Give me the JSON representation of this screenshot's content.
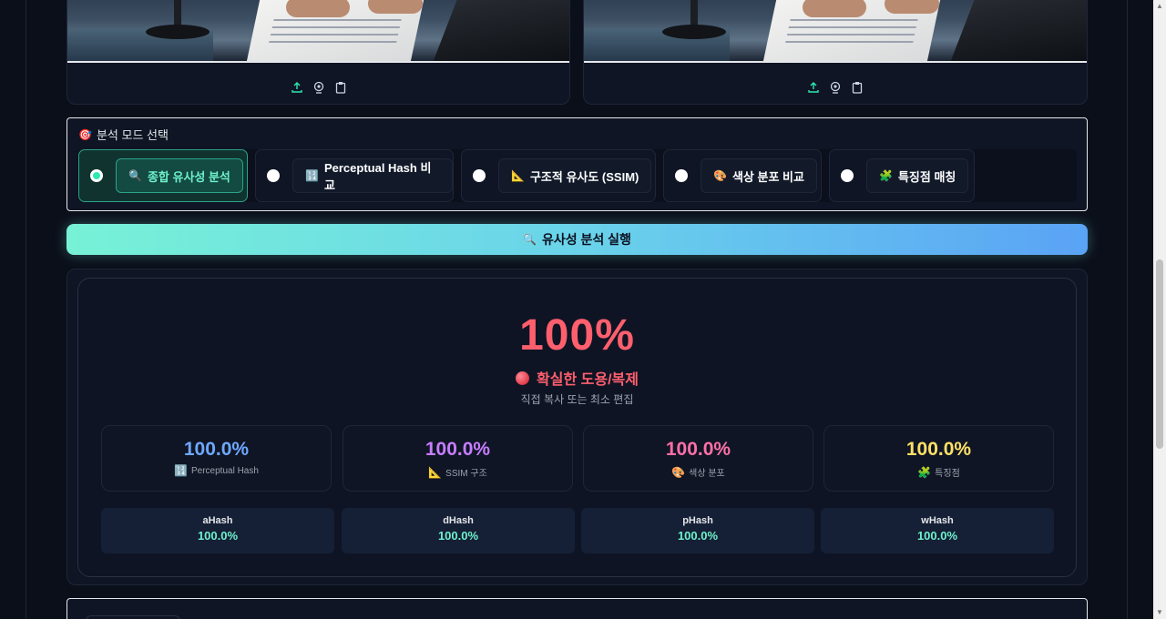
{
  "upload_panels": [
    {
      "toolbar": {
        "upload_icon": "upload-icon",
        "camera_icon": "webcam-icon",
        "paste_icon": "clipboard-icon"
      }
    },
    {
      "toolbar": {
        "upload_icon": "upload-icon",
        "camera_icon": "webcam-icon",
        "paste_icon": "clipboard-icon"
      }
    }
  ],
  "mode_selector": {
    "icon": "🎯",
    "title": "분석 모드 선택",
    "selected_index": 0,
    "options": [
      {
        "icon": "🔍",
        "label": "종합 유사성 분석"
      },
      {
        "icon": "🔢",
        "label": "Perceptual Hash 비교"
      },
      {
        "icon": "📐",
        "label": "구조적 유사도 (SSIM)"
      },
      {
        "icon": "🎨",
        "label": "색상 분포 비교"
      },
      {
        "icon": "🧩",
        "label": "특징점 매칭"
      }
    ]
  },
  "run_button": {
    "icon": "🔍",
    "label": "유사성 분석 실행"
  },
  "result": {
    "score": "100%",
    "verdict": "확실한 도용/복제",
    "verdict_color": "#ff5f6d",
    "description": "직접 복사 또는 최소 편집",
    "metrics": [
      {
        "value": "100.0%",
        "icon": "🔢",
        "label": "Perceptual Hash",
        "color": "#6ea8fe"
      },
      {
        "value": "100.0%",
        "icon": "📐",
        "label": "SSIM 구조",
        "color": "#c77dff"
      },
      {
        "value": "100.0%",
        "icon": "🎨",
        "label": "색상 분포",
        "color": "#ff6fa8"
      },
      {
        "value": "100.0%",
        "icon": "🧩",
        "label": "특징점",
        "color": "#ffe066"
      }
    ],
    "hashes": [
      {
        "name": "aHash",
        "value": "100.0%"
      },
      {
        "name": "dHash",
        "value": "100.0%"
      },
      {
        "name": "pHash",
        "value": "100.0%"
      },
      {
        "name": "wHash",
        "value": "100.0%"
      }
    ]
  },
  "colors": {
    "accent": "#6ff2cc",
    "danger": "#ff5f6d",
    "background": "#0b0f1a"
  }
}
